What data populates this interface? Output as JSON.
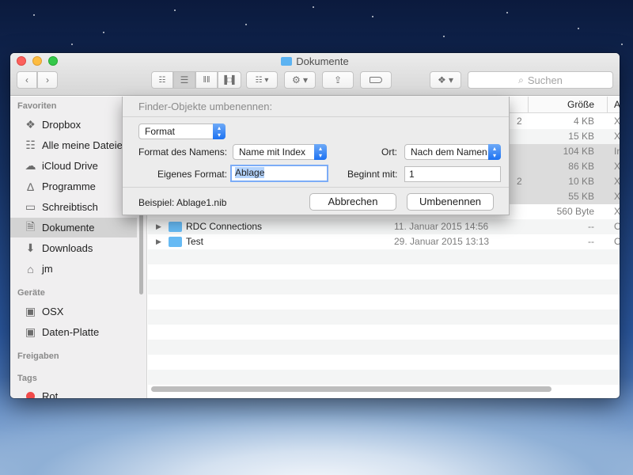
{
  "window": {
    "title": "Dokumente",
    "search_placeholder": "Suchen"
  },
  "toolbar": {
    "back_icon": "chevron-left-icon",
    "forward_icon": "chevron-right-icon",
    "view_modes": [
      "icon-view",
      "list-view",
      "column-view",
      "cover-flow-view"
    ],
    "active_view": "list-view",
    "arrange_icon": "arrange-icon",
    "action_icon": "gear-icon",
    "share_icon": "share-icon",
    "tag_icon": "tag-icon",
    "dropbox_icon": "dropbox-icon"
  },
  "sidebar": {
    "favorites_header": "Favoriten",
    "favorites": [
      {
        "label": "Dropbox",
        "icon": "dropbox-icon"
      },
      {
        "label": "Alle meine Dateien",
        "icon": "all-files-icon"
      },
      {
        "label": "iCloud Drive",
        "icon": "cloud-icon"
      },
      {
        "label": "Programme",
        "icon": "applications-icon"
      },
      {
        "label": "Schreibtisch",
        "icon": "desktop-icon"
      },
      {
        "label": "Dokumente",
        "icon": "document-icon",
        "selected": true
      },
      {
        "label": "Downloads",
        "icon": "download-icon"
      },
      {
        "label": "jm",
        "icon": "home-icon"
      }
    ],
    "devices_header": "Geräte",
    "devices": [
      {
        "label": "OSX",
        "icon": "disk-icon"
      },
      {
        "label": "Daten-Platte",
        "icon": "disk-icon"
      }
    ],
    "shared_header": "Freigaben",
    "tags_header": "Tags",
    "tags": [
      {
        "label": "Rot",
        "color": "#f14a4a"
      }
    ]
  },
  "list": {
    "column_size": "Größe",
    "column_kind": "A",
    "rows": [
      {
        "date_tail": "2",
        "size": "4 KB",
        "kind": "X"
      },
      {
        "date_tail": "",
        "size": "15 KB",
        "kind": "X"
      },
      {
        "date_tail": "",
        "size": "104 KB",
        "kind": "In"
      },
      {
        "date_tail": "",
        "size": "86 KB",
        "kind": "X"
      },
      {
        "date_tail": "2",
        "size": "10 KB",
        "kind": "X"
      },
      {
        "date_tail": "",
        "size": "55 KB",
        "kind": "X"
      },
      {
        "date_tail": "",
        "size": "560 Byte",
        "kind": "X"
      },
      {
        "name": "RDC Connections",
        "date": "11. Januar 2015 14:56",
        "size": "--",
        "kind": "O"
      },
      {
        "name": "Test",
        "date": "29. Januar 2015 13:13",
        "size": "--",
        "kind": "O"
      }
    ]
  },
  "rename_dialog": {
    "title": "Finder-Objekte umbenennen:",
    "mode_select": "Format",
    "name_format_label": "Format des Namens:",
    "name_format_value": "Name mit Index",
    "location_label": "Ort:",
    "location_value": "Nach dem Namen",
    "custom_format_label": "Eigenes Format:",
    "custom_format_value": "Ablage",
    "start_label": "Beginnt mit:",
    "start_value": "1",
    "example": "Beispiel: Ablage1.nib",
    "cancel": "Abbrechen",
    "rename": "Umbenennen"
  }
}
